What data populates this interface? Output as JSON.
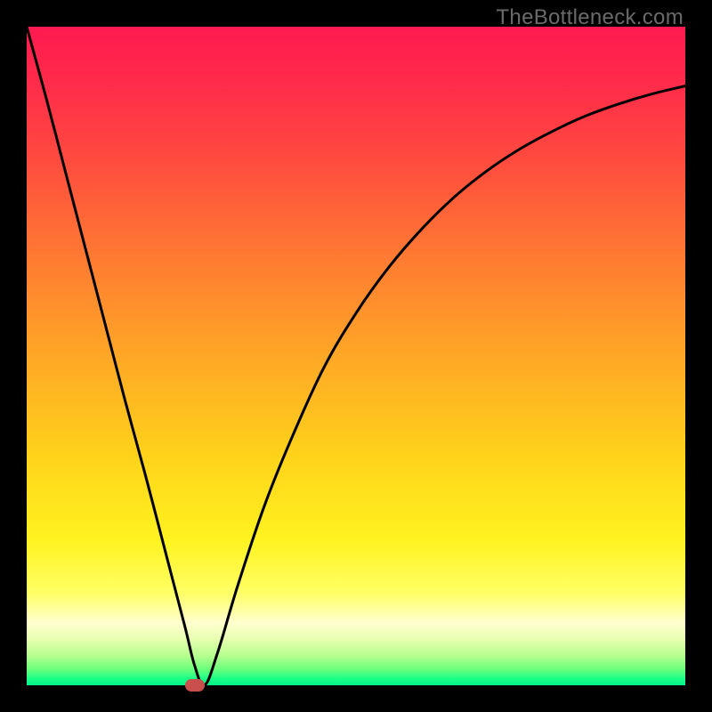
{
  "watermark": "TheBottleneck.com",
  "colors": {
    "frame": "#000000",
    "marker": "#c94f4d",
    "curve": "#000000",
    "gradient_stops": [
      {
        "offset": 0.0,
        "color": "#ff1a50"
      },
      {
        "offset": 0.08,
        "color": "#ff2a4a"
      },
      {
        "offset": 0.2,
        "color": "#ff4a3f"
      },
      {
        "offset": 0.35,
        "color": "#ff7a32"
      },
      {
        "offset": 0.5,
        "color": "#ffa726"
      },
      {
        "offset": 0.65,
        "color": "#ffd21a"
      },
      {
        "offset": 0.78,
        "color": "#fff320"
      },
      {
        "offset": 0.86,
        "color": "#ffff66"
      },
      {
        "offset": 0.905,
        "color": "#ffffcf"
      },
      {
        "offset": 0.93,
        "color": "#e7ffb0"
      },
      {
        "offset": 0.955,
        "color": "#b6ff8e"
      },
      {
        "offset": 0.975,
        "color": "#6eff7c"
      },
      {
        "offset": 0.99,
        "color": "#1aff86"
      },
      {
        "offset": 1.0,
        "color": "#04f38a"
      }
    ]
  },
  "chart_data": {
    "type": "line",
    "title": "",
    "xlabel": "",
    "ylabel": "",
    "xlim": [
      0,
      100
    ],
    "ylim": [
      0,
      100
    ],
    "grid": false,
    "legend": false,
    "series": [
      {
        "name": "curve",
        "x": [
          0,
          3,
          6,
          9,
          12,
          15,
          18,
          21,
          24,
          25.5,
          27,
          29,
          32,
          36,
          40,
          45,
          50,
          55,
          60,
          65,
          70,
          75,
          80,
          85,
          90,
          95,
          100
        ],
        "y": [
          100,
          89,
          77.5,
          66,
          54.5,
          43,
          32,
          20.5,
          9,
          3,
          0,
          5,
          15,
          27,
          37,
          48,
          56.5,
          63.5,
          69.3,
          74.2,
          78.2,
          81.5,
          84.2,
          86.5,
          88.3,
          89.8,
          91
        ]
      }
    ],
    "marker": {
      "x": 25.5,
      "y": 0
    }
  }
}
